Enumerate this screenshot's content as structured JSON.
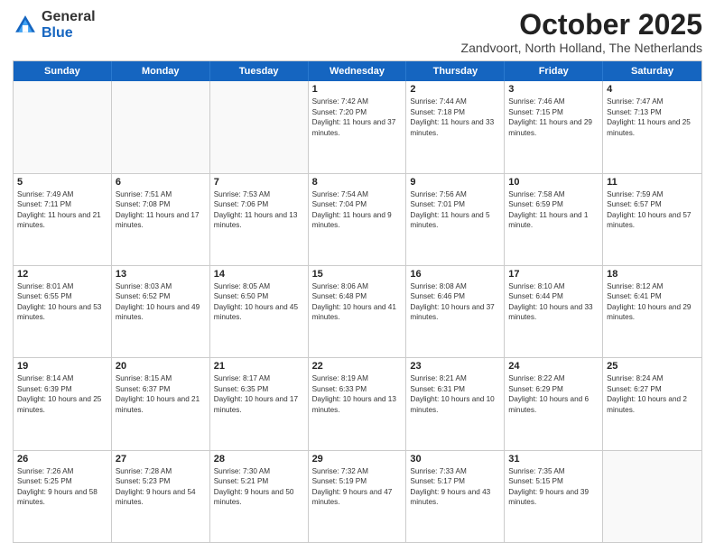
{
  "header": {
    "logo_general": "General",
    "logo_blue": "Blue",
    "month_title": "October 2025",
    "subtitle": "Zandvoort, North Holland, The Netherlands"
  },
  "days_of_week": [
    "Sunday",
    "Monday",
    "Tuesday",
    "Wednesday",
    "Thursday",
    "Friday",
    "Saturday"
  ],
  "weeks": [
    [
      {
        "day": "",
        "sunrise": "",
        "sunset": "",
        "daylight": ""
      },
      {
        "day": "",
        "sunrise": "",
        "sunset": "",
        "daylight": ""
      },
      {
        "day": "",
        "sunrise": "",
        "sunset": "",
        "daylight": ""
      },
      {
        "day": "1",
        "sunrise": "Sunrise: 7:42 AM",
        "sunset": "Sunset: 7:20 PM",
        "daylight": "Daylight: 11 hours and 37 minutes."
      },
      {
        "day": "2",
        "sunrise": "Sunrise: 7:44 AM",
        "sunset": "Sunset: 7:18 PM",
        "daylight": "Daylight: 11 hours and 33 minutes."
      },
      {
        "day": "3",
        "sunrise": "Sunrise: 7:46 AM",
        "sunset": "Sunset: 7:15 PM",
        "daylight": "Daylight: 11 hours and 29 minutes."
      },
      {
        "day": "4",
        "sunrise": "Sunrise: 7:47 AM",
        "sunset": "Sunset: 7:13 PM",
        "daylight": "Daylight: 11 hours and 25 minutes."
      }
    ],
    [
      {
        "day": "5",
        "sunrise": "Sunrise: 7:49 AM",
        "sunset": "Sunset: 7:11 PM",
        "daylight": "Daylight: 11 hours and 21 minutes."
      },
      {
        "day": "6",
        "sunrise": "Sunrise: 7:51 AM",
        "sunset": "Sunset: 7:08 PM",
        "daylight": "Daylight: 11 hours and 17 minutes."
      },
      {
        "day": "7",
        "sunrise": "Sunrise: 7:53 AM",
        "sunset": "Sunset: 7:06 PM",
        "daylight": "Daylight: 11 hours and 13 minutes."
      },
      {
        "day": "8",
        "sunrise": "Sunrise: 7:54 AM",
        "sunset": "Sunset: 7:04 PM",
        "daylight": "Daylight: 11 hours and 9 minutes."
      },
      {
        "day": "9",
        "sunrise": "Sunrise: 7:56 AM",
        "sunset": "Sunset: 7:01 PM",
        "daylight": "Daylight: 11 hours and 5 minutes."
      },
      {
        "day": "10",
        "sunrise": "Sunrise: 7:58 AM",
        "sunset": "Sunset: 6:59 PM",
        "daylight": "Daylight: 11 hours and 1 minute."
      },
      {
        "day": "11",
        "sunrise": "Sunrise: 7:59 AM",
        "sunset": "Sunset: 6:57 PM",
        "daylight": "Daylight: 10 hours and 57 minutes."
      }
    ],
    [
      {
        "day": "12",
        "sunrise": "Sunrise: 8:01 AM",
        "sunset": "Sunset: 6:55 PM",
        "daylight": "Daylight: 10 hours and 53 minutes."
      },
      {
        "day": "13",
        "sunrise": "Sunrise: 8:03 AM",
        "sunset": "Sunset: 6:52 PM",
        "daylight": "Daylight: 10 hours and 49 minutes."
      },
      {
        "day": "14",
        "sunrise": "Sunrise: 8:05 AM",
        "sunset": "Sunset: 6:50 PM",
        "daylight": "Daylight: 10 hours and 45 minutes."
      },
      {
        "day": "15",
        "sunrise": "Sunrise: 8:06 AM",
        "sunset": "Sunset: 6:48 PM",
        "daylight": "Daylight: 10 hours and 41 minutes."
      },
      {
        "day": "16",
        "sunrise": "Sunrise: 8:08 AM",
        "sunset": "Sunset: 6:46 PM",
        "daylight": "Daylight: 10 hours and 37 minutes."
      },
      {
        "day": "17",
        "sunrise": "Sunrise: 8:10 AM",
        "sunset": "Sunset: 6:44 PM",
        "daylight": "Daylight: 10 hours and 33 minutes."
      },
      {
        "day": "18",
        "sunrise": "Sunrise: 8:12 AM",
        "sunset": "Sunset: 6:41 PM",
        "daylight": "Daylight: 10 hours and 29 minutes."
      }
    ],
    [
      {
        "day": "19",
        "sunrise": "Sunrise: 8:14 AM",
        "sunset": "Sunset: 6:39 PM",
        "daylight": "Daylight: 10 hours and 25 minutes."
      },
      {
        "day": "20",
        "sunrise": "Sunrise: 8:15 AM",
        "sunset": "Sunset: 6:37 PM",
        "daylight": "Daylight: 10 hours and 21 minutes."
      },
      {
        "day": "21",
        "sunrise": "Sunrise: 8:17 AM",
        "sunset": "Sunset: 6:35 PM",
        "daylight": "Daylight: 10 hours and 17 minutes."
      },
      {
        "day": "22",
        "sunrise": "Sunrise: 8:19 AM",
        "sunset": "Sunset: 6:33 PM",
        "daylight": "Daylight: 10 hours and 13 minutes."
      },
      {
        "day": "23",
        "sunrise": "Sunrise: 8:21 AM",
        "sunset": "Sunset: 6:31 PM",
        "daylight": "Daylight: 10 hours and 10 minutes."
      },
      {
        "day": "24",
        "sunrise": "Sunrise: 8:22 AM",
        "sunset": "Sunset: 6:29 PM",
        "daylight": "Daylight: 10 hours and 6 minutes."
      },
      {
        "day": "25",
        "sunrise": "Sunrise: 8:24 AM",
        "sunset": "Sunset: 6:27 PM",
        "daylight": "Daylight: 10 hours and 2 minutes."
      }
    ],
    [
      {
        "day": "26",
        "sunrise": "Sunrise: 7:26 AM",
        "sunset": "Sunset: 5:25 PM",
        "daylight": "Daylight: 9 hours and 58 minutes."
      },
      {
        "day": "27",
        "sunrise": "Sunrise: 7:28 AM",
        "sunset": "Sunset: 5:23 PM",
        "daylight": "Daylight: 9 hours and 54 minutes."
      },
      {
        "day": "28",
        "sunrise": "Sunrise: 7:30 AM",
        "sunset": "Sunset: 5:21 PM",
        "daylight": "Daylight: 9 hours and 50 minutes."
      },
      {
        "day": "29",
        "sunrise": "Sunrise: 7:32 AM",
        "sunset": "Sunset: 5:19 PM",
        "daylight": "Daylight: 9 hours and 47 minutes."
      },
      {
        "day": "30",
        "sunrise": "Sunrise: 7:33 AM",
        "sunset": "Sunset: 5:17 PM",
        "daylight": "Daylight: 9 hours and 43 minutes."
      },
      {
        "day": "31",
        "sunrise": "Sunrise: 7:35 AM",
        "sunset": "Sunset: 5:15 PM",
        "daylight": "Daylight: 9 hours and 39 minutes."
      },
      {
        "day": "",
        "sunrise": "",
        "sunset": "",
        "daylight": ""
      }
    ]
  ]
}
